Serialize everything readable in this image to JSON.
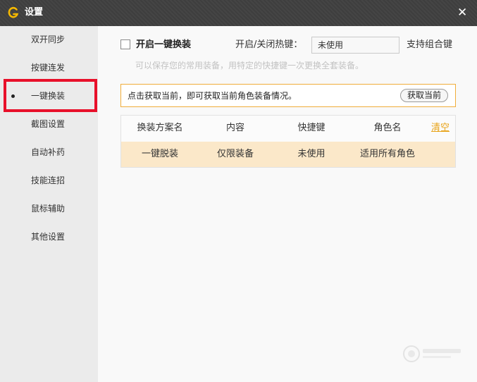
{
  "window": {
    "title": "设置",
    "close_glyph": "✕"
  },
  "sidebar": {
    "items": [
      {
        "label": "双开同步"
      },
      {
        "label": "按键连发"
      },
      {
        "label": "一键换装",
        "active": true
      },
      {
        "label": "截图设置"
      },
      {
        "label": "自动补药"
      },
      {
        "label": "技能连招"
      },
      {
        "label": "鼠标辅助"
      },
      {
        "label": "其他设置"
      }
    ]
  },
  "main": {
    "enable_label": "开启一键换装",
    "enabled": false,
    "hotkey_label": "开启/关闭热键：",
    "hotkey_value": "未使用",
    "combo_label": "支持组合键",
    "hint": "可以保存您的常用装备，用特定的快捷键一次更换全套装备。",
    "notice": {
      "text": "点击获取当前，即可获取当前角色装备情况。",
      "button": "获取当前"
    },
    "table": {
      "headers": [
        "换装方案名",
        "内容",
        "快捷键",
        "角色名"
      ],
      "clear_label": "清空",
      "rows": [
        [
          "一键脱装",
          "仅限装备",
          "未使用",
          "适用所有角色"
        ]
      ]
    }
  },
  "colors": {
    "titlebar": "#3e3e3e",
    "accent": "#f0ad3a",
    "highlight_border": "#e8102a",
    "selected_row": "#fbe8c9",
    "link": "#e8a318"
  }
}
